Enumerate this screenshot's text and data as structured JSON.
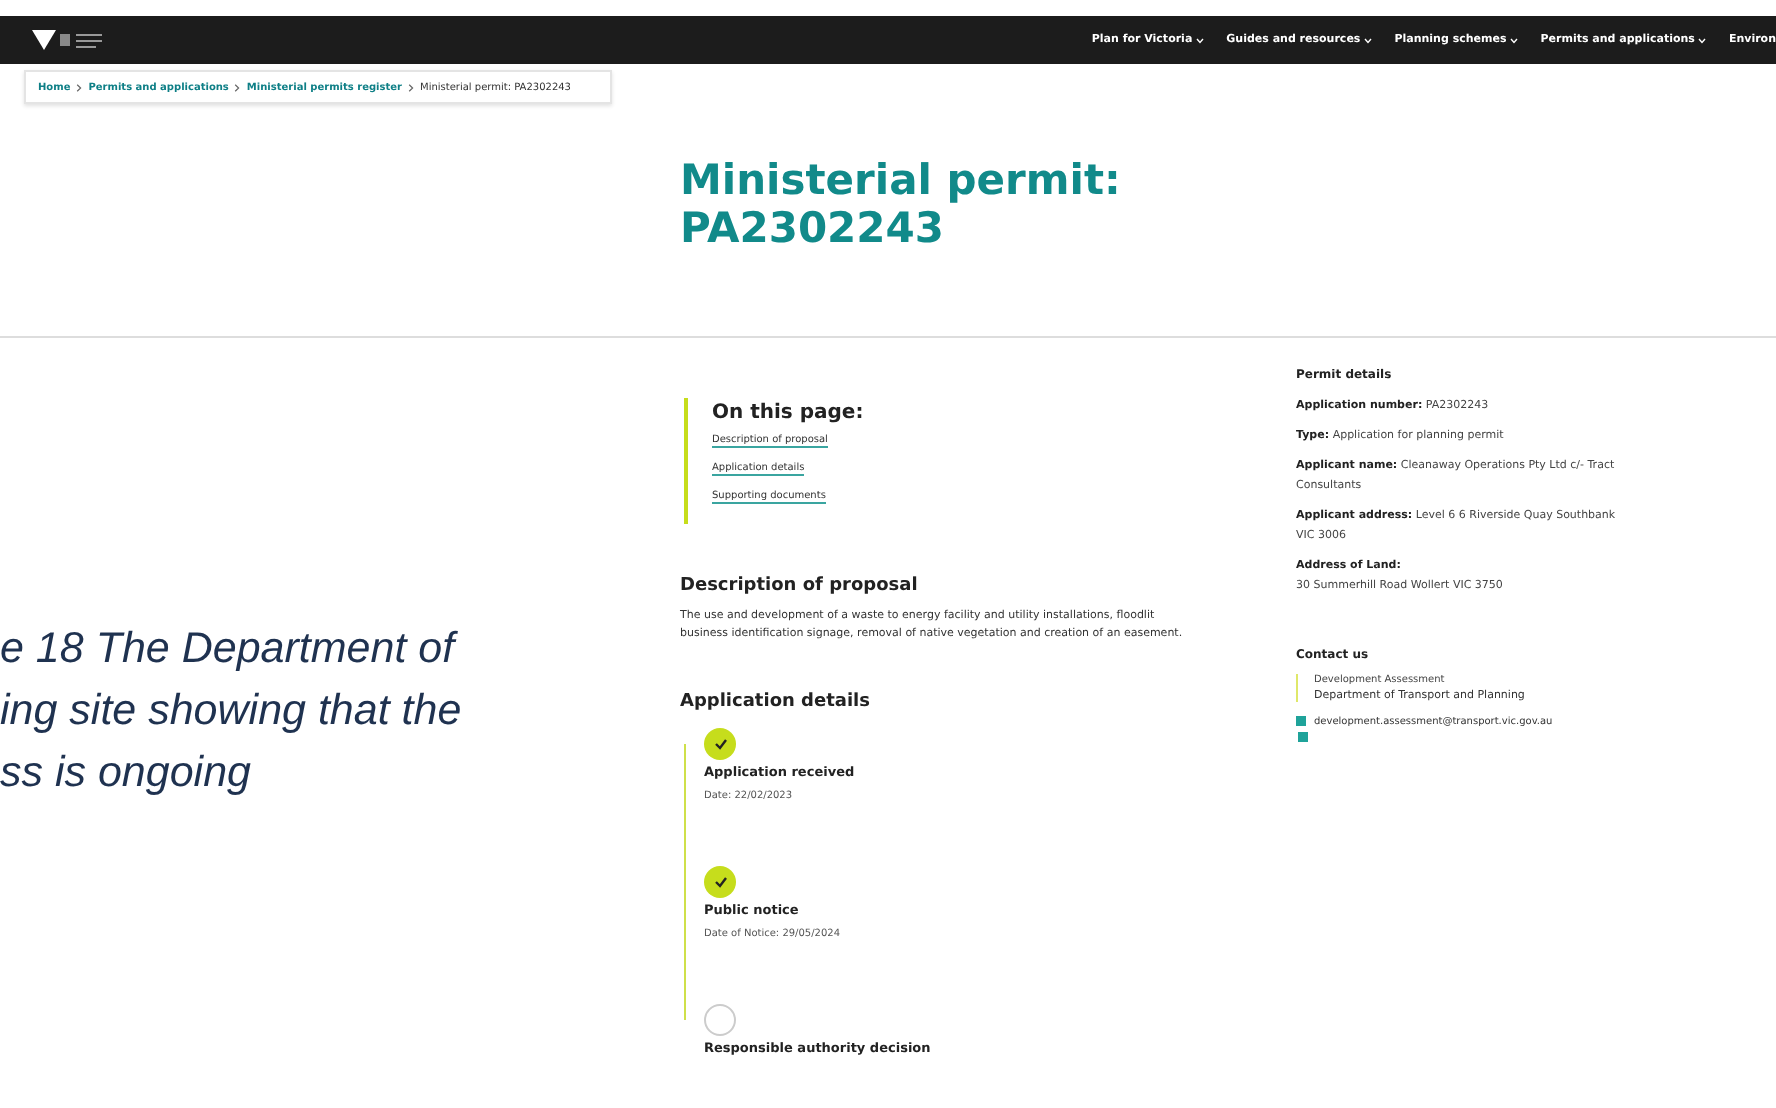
{
  "nav": [
    {
      "label": "Plan for Victoria",
      "caret": true
    },
    {
      "label": "Guides and resources",
      "caret": true
    },
    {
      "label": "Planning schemes",
      "caret": true
    },
    {
      "label": "Permits and applications",
      "caret": true
    },
    {
      "label": "Environ",
      "caret": false
    }
  ],
  "breadcrumb": [
    {
      "label": "Home",
      "link": true
    },
    {
      "label": "Permits and applications",
      "link": true
    },
    {
      "label": "Ministerial permits register",
      "link": true
    },
    {
      "label": "Ministerial permit: PA2302243",
      "link": false
    }
  ],
  "title": [
    "Ministerial permit:",
    "PA2302243"
  ],
  "caption": [
    "e 18 The Department of",
    "ing site showing that the",
    "ss is ongoing"
  ],
  "on_this_page": {
    "heading": "On this page:",
    "links": [
      "Description of proposal",
      "Application details",
      "Supporting documents"
    ]
  },
  "description": {
    "heading": "Description of proposal",
    "text": "The use and development of a waste to energy facility and utility installations, floodlit business identification signage, removal of native vegetation and creation of an easement."
  },
  "application_details": {
    "heading": "Application details",
    "steps": [
      {
        "label": "Application received",
        "date": "Date: 22/02/2023",
        "done": true
      },
      {
        "label": "Public notice",
        "date": "Date of Notice: 29/05/2024",
        "done": true
      },
      {
        "label": "Responsible authority decision",
        "done": false
      }
    ]
  },
  "permit_details": {
    "heading": "Permit details",
    "rows": [
      {
        "label": "Application number:",
        "value": "PA2302243",
        "block": false
      },
      {
        "label": "Type:",
        "value": "Application for planning permit",
        "block": false
      },
      {
        "label": "Applicant name:",
        "value": "Cleanaway Operations Pty Ltd c/- Tract Consultants",
        "block": false
      },
      {
        "label": "Applicant address:",
        "value": "Level 6 6 Riverside Quay Southbank VIC 3006",
        "block": false
      },
      {
        "label": "Address of Land:",
        "value": "30 Summerhill Road Wollert VIC 3750",
        "block": true
      }
    ]
  },
  "contact": {
    "heading": "Contact us",
    "team": "Development Assessment",
    "department": "Department of Transport and Planning",
    "email": "development.assessment@transport.vic.gov.au"
  }
}
